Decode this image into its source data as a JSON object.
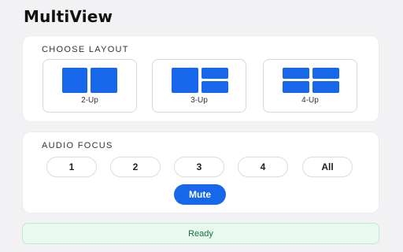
{
  "app": {
    "title": "MultiView"
  },
  "layout_section": {
    "label": "CHOOSE LAYOUT",
    "options": [
      {
        "label": "2-Up"
      },
      {
        "label": "3-Up"
      },
      {
        "label": "4-Up"
      }
    ]
  },
  "audio_section": {
    "label": "AUDIO FOCUS",
    "buttons": [
      "1",
      "2",
      "3",
      "4",
      "All"
    ],
    "mute_label": "Mute"
  },
  "status": {
    "text": "Ready"
  },
  "colors": {
    "accent": "#1767ea",
    "status_bg": "#e8faf0",
    "status_text": "#1c6b3f"
  }
}
